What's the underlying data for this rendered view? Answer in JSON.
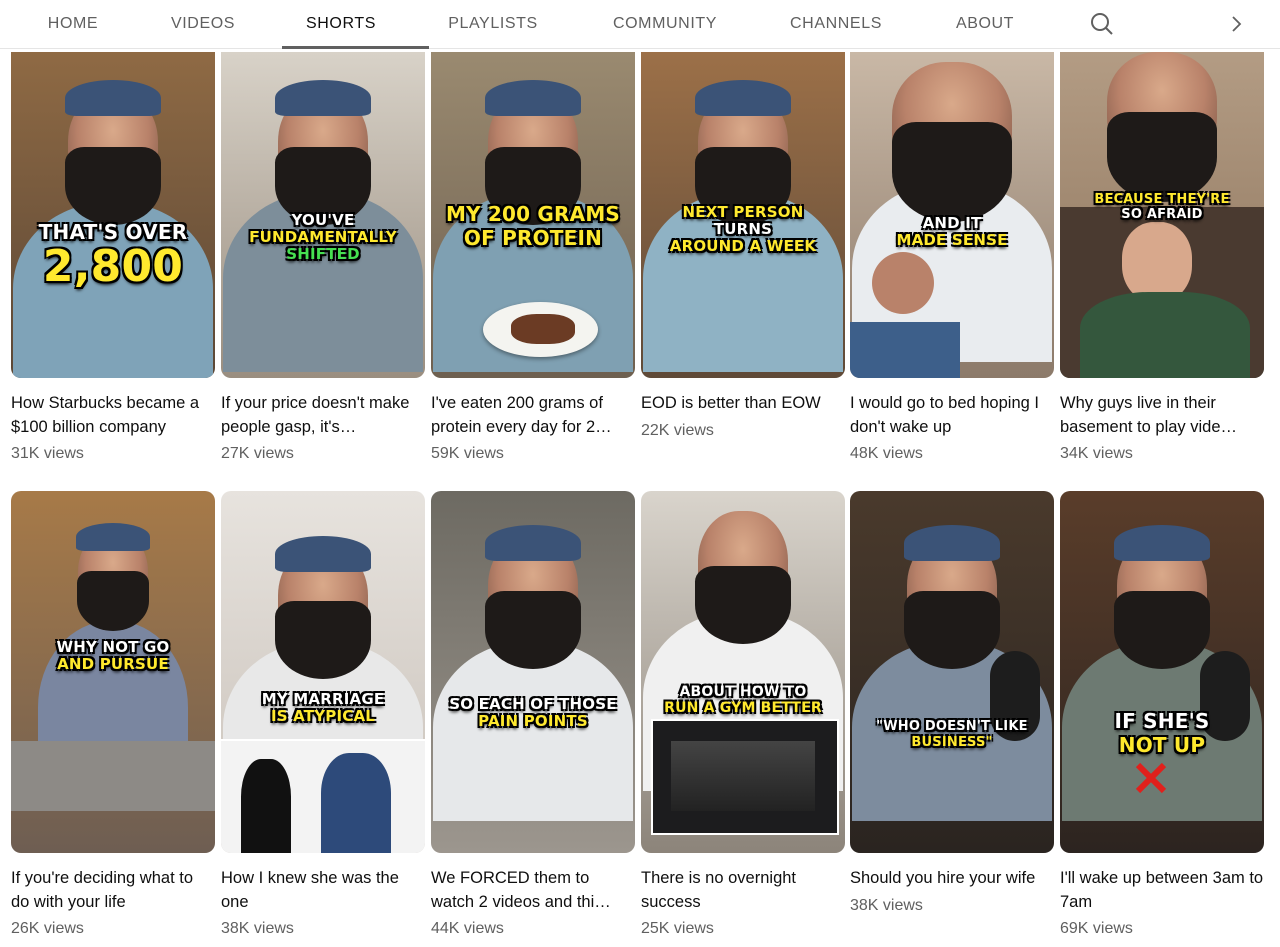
{
  "tabs": [
    {
      "label": "HOME"
    },
    {
      "label": "VIDEOS"
    },
    {
      "label": "SHORTS"
    },
    {
      "label": "PLAYLISTS"
    },
    {
      "label": "COMMUNITY"
    },
    {
      "label": "CHANNELS"
    },
    {
      "label": "ABOUT"
    }
  ],
  "active_tab": "SHORTS",
  "shorts": [
    {
      "title": "How Starbucks became a $100 billion company",
      "views": "31K views",
      "overlay": [
        "THAT'S OVER",
        "2,800"
      ]
    },
    {
      "title": "If your price doesn't make people gasp, it's…",
      "views": "27K views",
      "overlay": [
        "YOU'VE",
        "FUNDAMENTALLY",
        "SHIFTED"
      ]
    },
    {
      "title": "I've eaten 200 grams of protein every day for 2…",
      "views": "59K views",
      "overlay": [
        "MY 200 GRAMS",
        "OF PROTEIN"
      ]
    },
    {
      "title": "EOD is better than EOW",
      "views": "22K views",
      "overlay": [
        "NEXT PERSON",
        "TURNS",
        "AROUND A WEEK"
      ]
    },
    {
      "title": "I would go to bed hoping I don't wake up",
      "views": "48K views",
      "overlay": [
        "AND IT",
        "MADE SENSE"
      ]
    },
    {
      "title": "Why guys live in their basement to play vide…",
      "views": "34K views",
      "overlay": [
        "BECAUSE THEY'RE",
        "SO AFRAID"
      ]
    },
    {
      "title": "If you're deciding what to do with your life",
      "views": "26K views",
      "overlay": [
        "WHY NOT GO",
        "AND PURSUE"
      ]
    },
    {
      "title": "How I knew she was the one",
      "views": "38K views",
      "overlay": [
        "MY MARRIAGE",
        "IS ATYPICAL"
      ]
    },
    {
      "title": "We FORCED them to watch 2 videos and thi…",
      "views": "44K views",
      "overlay": [
        "SO EACH OF THOSE",
        "PAIN POINTS"
      ]
    },
    {
      "title": "There is no overnight success",
      "views": "25K views",
      "overlay": [
        "ABOUT HOW TO",
        "RUN A GYM BETTER"
      ]
    },
    {
      "title": "Should you hire your wife",
      "views": "38K views",
      "overlay": [
        "\"WHO DOESN'T LIKE",
        "BUSINESS\""
      ]
    },
    {
      "title": "I'll wake up between 3am to 7am",
      "views": "69K views",
      "overlay": [
        "IF SHE'S",
        "NOT UP"
      ]
    }
  ],
  "colors": {
    "accent": "#0f0f0f",
    "secondary_text": "#606060",
    "highlight_yellow": "#ffe92e"
  },
  "icons": {
    "search": "search-icon",
    "next": "chevron-right-icon"
  }
}
